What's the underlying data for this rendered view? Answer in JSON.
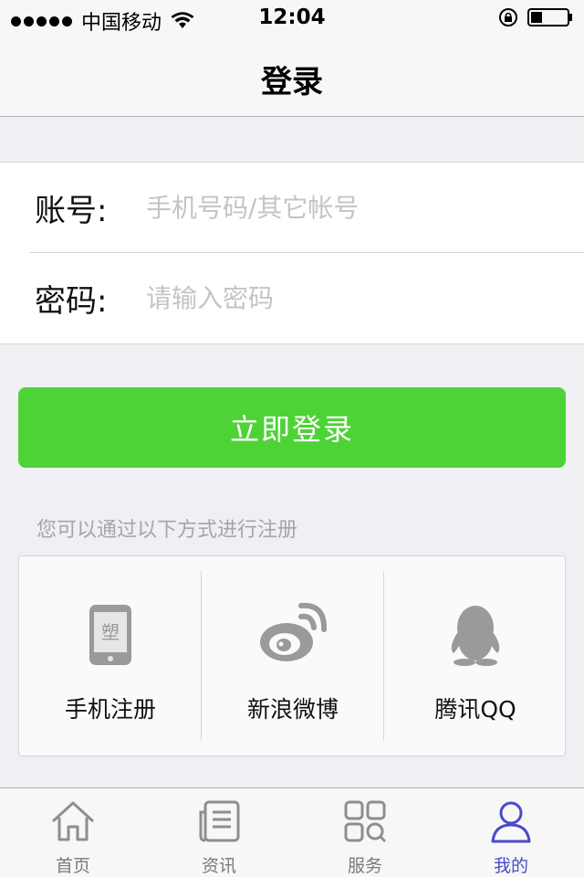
{
  "status_bar": {
    "carrier": "中国移动",
    "time": "12:04"
  },
  "nav": {
    "title": "登录"
  },
  "form": {
    "account_label": "账号:",
    "account_placeholder": "手机号码/其它帐号",
    "password_label": "密码:",
    "password_placeholder": "请输入密码"
  },
  "login_button": {
    "label": "立即登录"
  },
  "register": {
    "hint": "您可以通过以下方式进行注册",
    "options": [
      {
        "label": "手机注册",
        "icon": "phone-icon"
      },
      {
        "label": "新浪微博",
        "icon": "weibo-icon"
      },
      {
        "label": "腾讯QQ",
        "icon": "qq-icon"
      }
    ]
  },
  "tabs": [
    {
      "label": "首页",
      "icon": "home-icon"
    },
    {
      "label": "资讯",
      "icon": "news-icon"
    },
    {
      "label": "服务",
      "icon": "services-icon"
    },
    {
      "label": "我的",
      "icon": "profile-icon",
      "active": true
    }
  ],
  "colors": {
    "accent_green": "#4dd336",
    "active_tab": "#4a4acb",
    "background": "#efeff4"
  }
}
